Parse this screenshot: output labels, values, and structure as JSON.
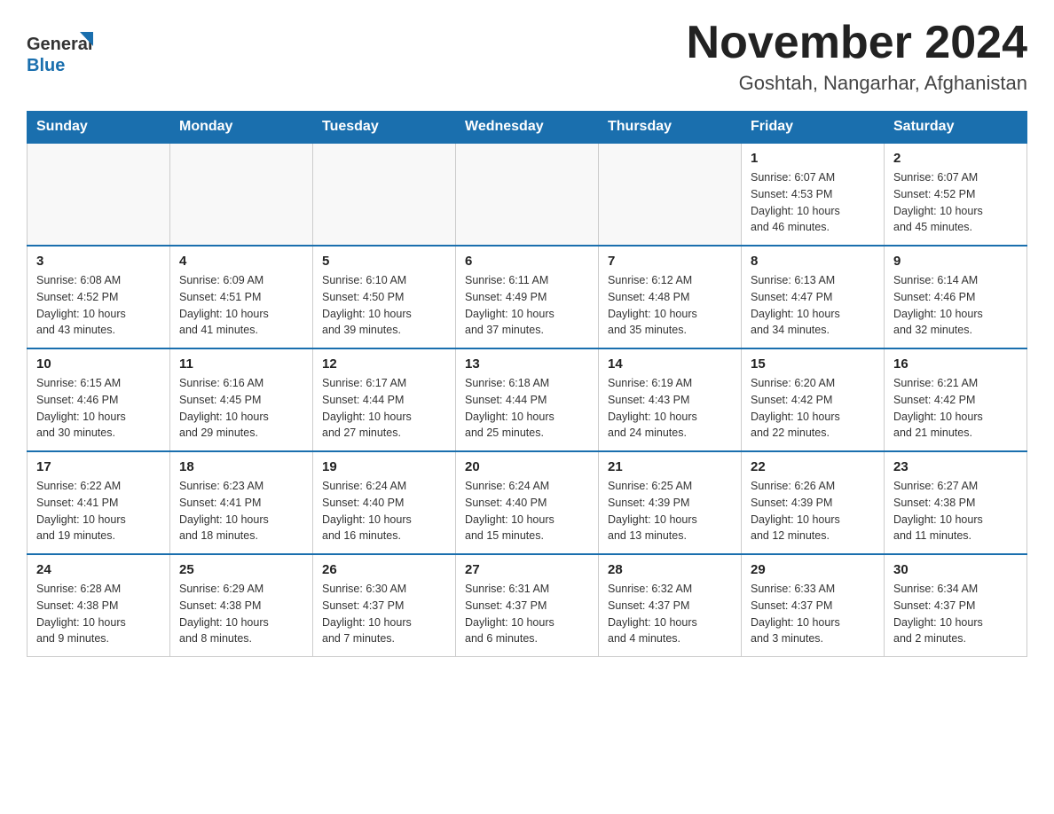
{
  "header": {
    "logo_line1": "General",
    "logo_line2": "Blue",
    "month_title": "November 2024",
    "location": "Goshtah, Nangarhar, Afghanistan"
  },
  "weekdays": [
    "Sunday",
    "Monday",
    "Tuesday",
    "Wednesday",
    "Thursday",
    "Friday",
    "Saturday"
  ],
  "weeks": [
    [
      {
        "day": "",
        "info": ""
      },
      {
        "day": "",
        "info": ""
      },
      {
        "day": "",
        "info": ""
      },
      {
        "day": "",
        "info": ""
      },
      {
        "day": "",
        "info": ""
      },
      {
        "day": "1",
        "info": "Sunrise: 6:07 AM\nSunset: 4:53 PM\nDaylight: 10 hours\nand 46 minutes."
      },
      {
        "day": "2",
        "info": "Sunrise: 6:07 AM\nSunset: 4:52 PM\nDaylight: 10 hours\nand 45 minutes."
      }
    ],
    [
      {
        "day": "3",
        "info": "Sunrise: 6:08 AM\nSunset: 4:52 PM\nDaylight: 10 hours\nand 43 minutes."
      },
      {
        "day": "4",
        "info": "Sunrise: 6:09 AM\nSunset: 4:51 PM\nDaylight: 10 hours\nand 41 minutes."
      },
      {
        "day": "5",
        "info": "Sunrise: 6:10 AM\nSunset: 4:50 PM\nDaylight: 10 hours\nand 39 minutes."
      },
      {
        "day": "6",
        "info": "Sunrise: 6:11 AM\nSunset: 4:49 PM\nDaylight: 10 hours\nand 37 minutes."
      },
      {
        "day": "7",
        "info": "Sunrise: 6:12 AM\nSunset: 4:48 PM\nDaylight: 10 hours\nand 35 minutes."
      },
      {
        "day": "8",
        "info": "Sunrise: 6:13 AM\nSunset: 4:47 PM\nDaylight: 10 hours\nand 34 minutes."
      },
      {
        "day": "9",
        "info": "Sunrise: 6:14 AM\nSunset: 4:46 PM\nDaylight: 10 hours\nand 32 minutes."
      }
    ],
    [
      {
        "day": "10",
        "info": "Sunrise: 6:15 AM\nSunset: 4:46 PM\nDaylight: 10 hours\nand 30 minutes."
      },
      {
        "day": "11",
        "info": "Sunrise: 6:16 AM\nSunset: 4:45 PM\nDaylight: 10 hours\nand 29 minutes."
      },
      {
        "day": "12",
        "info": "Sunrise: 6:17 AM\nSunset: 4:44 PM\nDaylight: 10 hours\nand 27 minutes."
      },
      {
        "day": "13",
        "info": "Sunrise: 6:18 AM\nSunset: 4:44 PM\nDaylight: 10 hours\nand 25 minutes."
      },
      {
        "day": "14",
        "info": "Sunrise: 6:19 AM\nSunset: 4:43 PM\nDaylight: 10 hours\nand 24 minutes."
      },
      {
        "day": "15",
        "info": "Sunrise: 6:20 AM\nSunset: 4:42 PM\nDaylight: 10 hours\nand 22 minutes."
      },
      {
        "day": "16",
        "info": "Sunrise: 6:21 AM\nSunset: 4:42 PM\nDaylight: 10 hours\nand 21 minutes."
      }
    ],
    [
      {
        "day": "17",
        "info": "Sunrise: 6:22 AM\nSunset: 4:41 PM\nDaylight: 10 hours\nand 19 minutes."
      },
      {
        "day": "18",
        "info": "Sunrise: 6:23 AM\nSunset: 4:41 PM\nDaylight: 10 hours\nand 18 minutes."
      },
      {
        "day": "19",
        "info": "Sunrise: 6:24 AM\nSunset: 4:40 PM\nDaylight: 10 hours\nand 16 minutes."
      },
      {
        "day": "20",
        "info": "Sunrise: 6:24 AM\nSunset: 4:40 PM\nDaylight: 10 hours\nand 15 minutes."
      },
      {
        "day": "21",
        "info": "Sunrise: 6:25 AM\nSunset: 4:39 PM\nDaylight: 10 hours\nand 13 minutes."
      },
      {
        "day": "22",
        "info": "Sunrise: 6:26 AM\nSunset: 4:39 PM\nDaylight: 10 hours\nand 12 minutes."
      },
      {
        "day": "23",
        "info": "Sunrise: 6:27 AM\nSunset: 4:38 PM\nDaylight: 10 hours\nand 11 minutes."
      }
    ],
    [
      {
        "day": "24",
        "info": "Sunrise: 6:28 AM\nSunset: 4:38 PM\nDaylight: 10 hours\nand 9 minutes."
      },
      {
        "day": "25",
        "info": "Sunrise: 6:29 AM\nSunset: 4:38 PM\nDaylight: 10 hours\nand 8 minutes."
      },
      {
        "day": "26",
        "info": "Sunrise: 6:30 AM\nSunset: 4:37 PM\nDaylight: 10 hours\nand 7 minutes."
      },
      {
        "day": "27",
        "info": "Sunrise: 6:31 AM\nSunset: 4:37 PM\nDaylight: 10 hours\nand 6 minutes."
      },
      {
        "day": "28",
        "info": "Sunrise: 6:32 AM\nSunset: 4:37 PM\nDaylight: 10 hours\nand 4 minutes."
      },
      {
        "day": "29",
        "info": "Sunrise: 6:33 AM\nSunset: 4:37 PM\nDaylight: 10 hours\nand 3 minutes."
      },
      {
        "day": "30",
        "info": "Sunrise: 6:34 AM\nSunset: 4:37 PM\nDaylight: 10 hours\nand 2 minutes."
      }
    ]
  ]
}
